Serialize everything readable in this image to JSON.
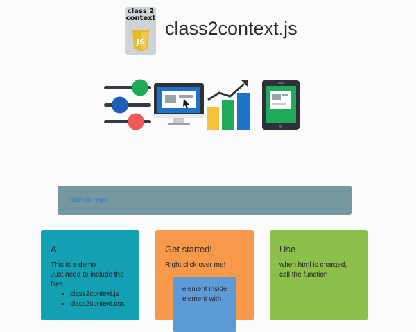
{
  "header": {
    "logo_text": "class 2 context",
    "logo_badge": "JS",
    "title": "class2context.js"
  },
  "colors": {
    "repo_bar": "#7597a0",
    "card_a": "#159fb3",
    "card_get_started": "#f7984a",
    "card_use": "#8cc04a",
    "inner_element": "#5d9ad6"
  },
  "hero": {
    "icons": [
      "sliders-icon",
      "monitor-icon",
      "growth-chart-icon",
      "tablet-icon"
    ]
  },
  "links": {
    "github": "- Github repo"
  },
  "cards": [
    {
      "title": "A",
      "lines": [
        "This is a demo",
        "Just need to include the files:"
      ],
      "files": [
        "class2context.js",
        "class2context.css"
      ]
    },
    {
      "title": "Get started!",
      "text": "Right click over me!",
      "inner_text": "element inside element with"
    },
    {
      "title": "Use",
      "text": "when html is charged, call the function"
    }
  ]
}
